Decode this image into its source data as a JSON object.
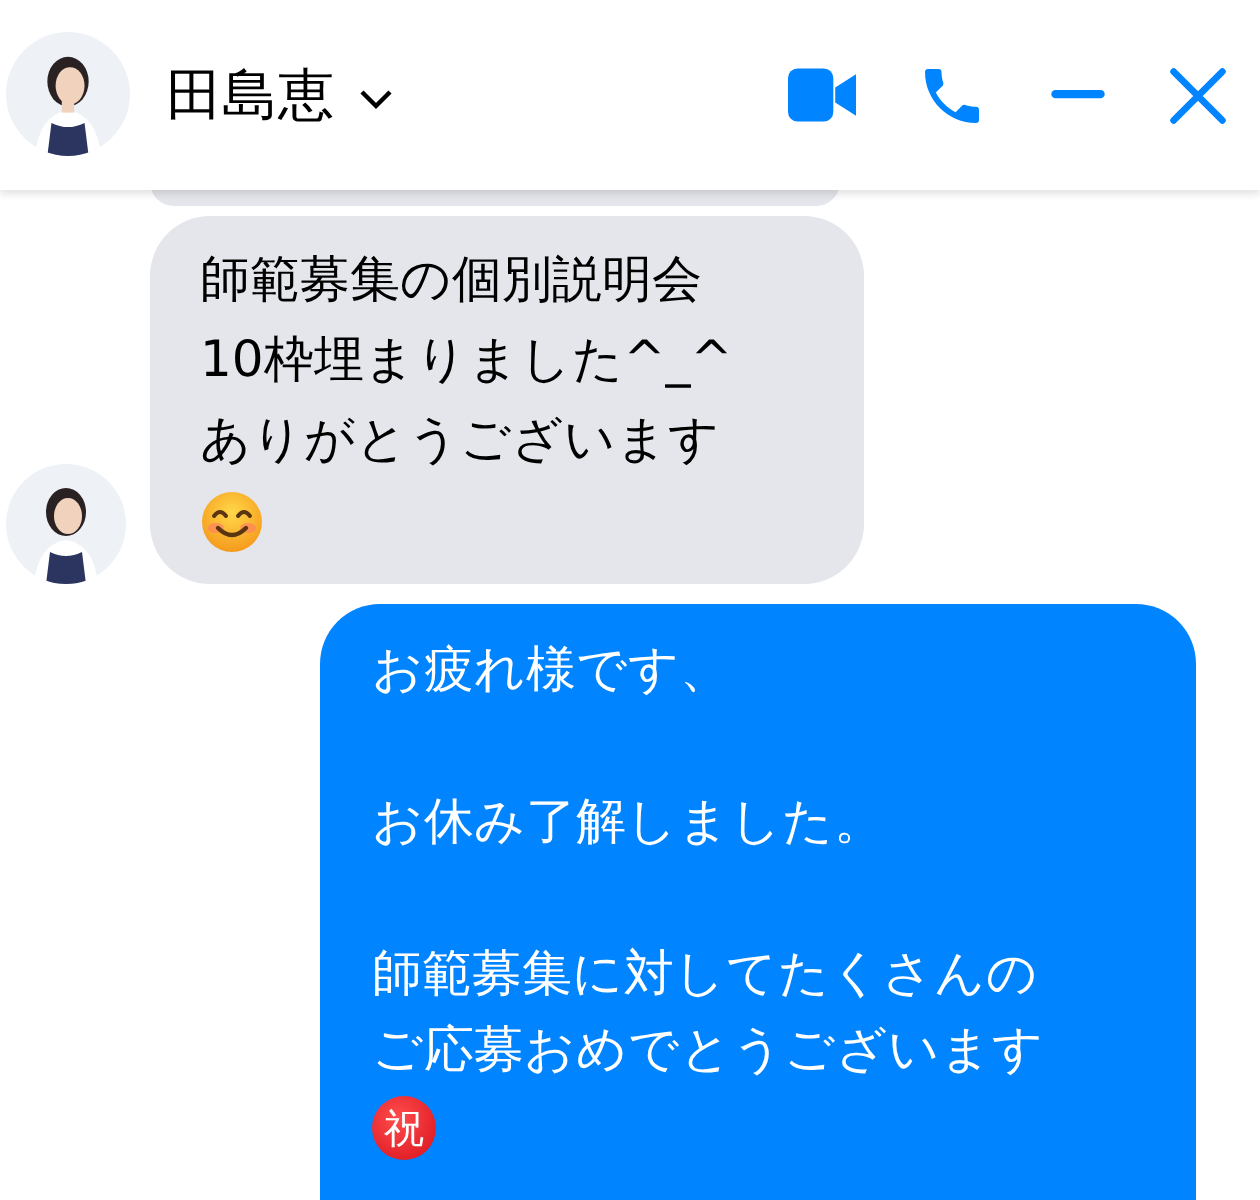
{
  "header": {
    "name": "田島恵"
  },
  "messages": [
    {
      "kind": "incoming"
    },
    {
      "kind": "incoming",
      "lines": [
        {
          "kind": "text",
          "text": "師範募集の個別説明会"
        },
        {
          "kind": "text",
          "text": "10枠埋まりました^_^"
        },
        {
          "kind": "text",
          "text": "ありがとうございます"
        },
        {
          "kind": "smile"
        }
      ]
    },
    {
      "kind": "outgoing",
      "lines": [
        {
          "kind": "text",
          "text": "お疲れ様です、"
        },
        {
          "kind": "blank"
        },
        {
          "kind": "text",
          "text": "お休み了解しました。"
        },
        {
          "kind": "blank"
        },
        {
          "kind": "text",
          "text": "師範募集に対してたくさんの"
        },
        {
          "kind": "text",
          "text": "ご応募おめでとうございます"
        },
        {
          "kind": "badge",
          "text": "祝"
        }
      ]
    }
  ]
}
